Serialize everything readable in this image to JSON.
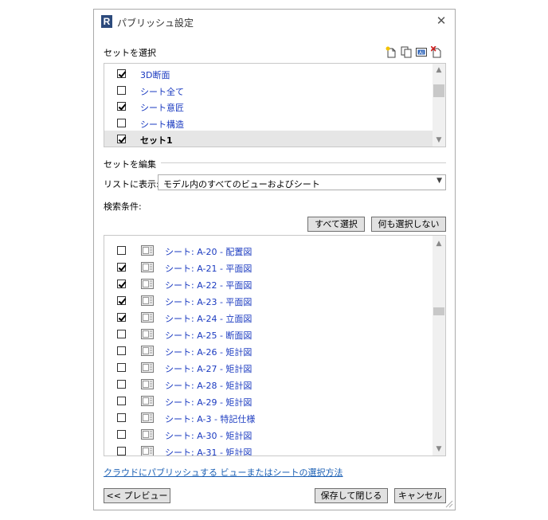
{
  "window": {
    "title": "パブリッシュ設定",
    "close_glyph": "✕"
  },
  "select_set": {
    "heading": "セットを選択",
    "toolbar": [
      "new-set-icon",
      "duplicate-set-icon",
      "rename-set-icon",
      "delete-set-icon"
    ],
    "sets": [
      {
        "label": "3D断面",
        "checked": true,
        "selected": false
      },
      {
        "label": "シート全て",
        "checked": false,
        "selected": false
      },
      {
        "label": "シート意匠",
        "checked": true,
        "selected": false
      },
      {
        "label": "シート構造",
        "checked": false,
        "selected": false
      },
      {
        "label": "セット1",
        "checked": true,
        "selected": true
      }
    ]
  },
  "edit_set": {
    "heading": "セットを編集",
    "show_in_list_label": "リストに表示:",
    "show_in_list_value": "モデル内のすべてのビューおよびシート",
    "search_label": "検索条件:",
    "search_value": "",
    "select_all_label": "すべて選択",
    "select_none_label": "何も選択しない",
    "items": [
      {
        "label": "シート: A-20 - 配置図",
        "checked": false
      },
      {
        "label": "シート: A-21 - 平面図",
        "checked": true
      },
      {
        "label": "シート: A-22 - 平面図",
        "checked": true
      },
      {
        "label": "シート: A-23 - 平面図",
        "checked": true
      },
      {
        "label": "シート: A-24 - 立面図",
        "checked": true
      },
      {
        "label": "シート: A-25 - 断面図",
        "checked": false
      },
      {
        "label": "シート: A-26 - 矩計図",
        "checked": false
      },
      {
        "label": "シート: A-27 - 矩計図",
        "checked": false
      },
      {
        "label": "シート: A-28 - 矩計図",
        "checked": false
      },
      {
        "label": "シート: A-29 - 矩計図",
        "checked": false
      },
      {
        "label": "シート: A-3 - 特記仕様",
        "checked": false
      },
      {
        "label": "シート: A-30 - 矩計図",
        "checked": false
      },
      {
        "label": "シート: A-31 - 矩計図",
        "checked": false
      }
    ]
  },
  "footer": {
    "help_link": "クラウドにパブリッシュする ビューまたはシートの選択方法",
    "preview_label": "<< プレビュー",
    "save_close_label": "保存して閉じる",
    "cancel_label": "キャンセル"
  },
  "colors": {
    "item_text": "#1a3ac0",
    "link": "#1a5fb4",
    "selected_row": "#e6e6e6"
  }
}
